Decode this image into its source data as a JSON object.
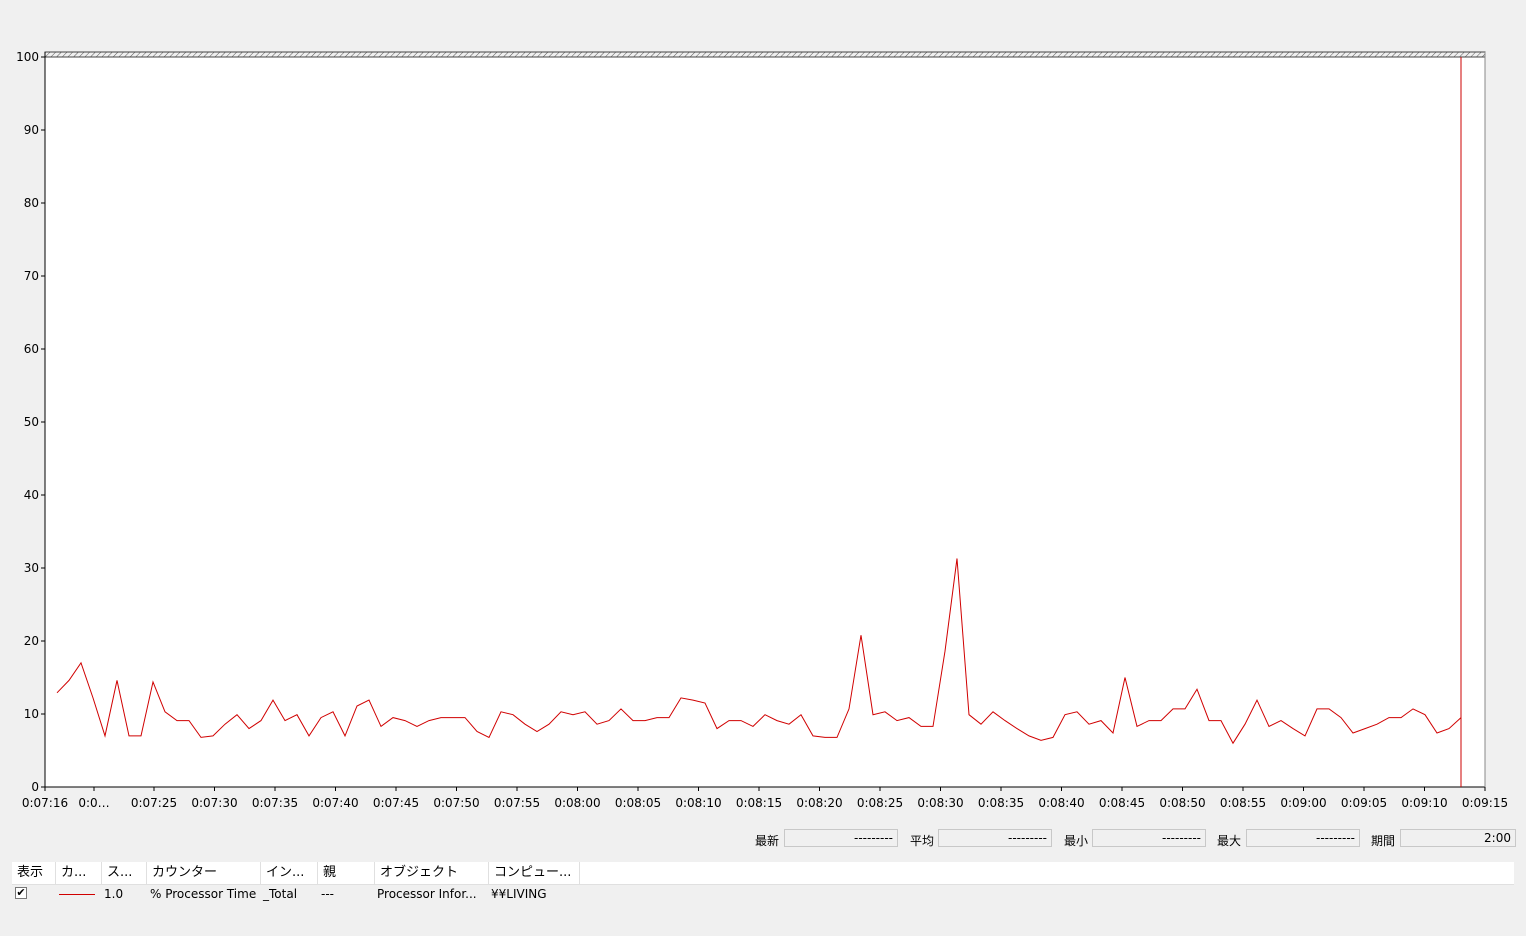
{
  "chart_data": {
    "type": "line",
    "ylim": [
      0,
      100
    ],
    "yticks": [
      "0",
      "10",
      "20",
      "30",
      "40",
      "50",
      "60",
      "70",
      "80",
      "90",
      "100"
    ],
    "xtick_labels": [
      "0:07:16",
      "0:0…",
      "0:07:25",
      "0:07:30",
      "0:07:35",
      "0:07:40",
      "0:07:45",
      "0:07:50",
      "0:07:55",
      "0:08:00",
      "0:08:05",
      "0:08:10",
      "0:08:15",
      "0:08:20",
      "0:08:25",
      "0:08:30",
      "0:08:35",
      "0:08:40",
      "0:08:45",
      "0:08:50",
      "0:08:55",
      "0:09:00",
      "0:09:05",
      "0:09:10",
      "0:09:15"
    ],
    "series": [
      {
        "name": "% Processor Time",
        "color": "#d00000",
        "values": [
          12.9,
          14.6,
          17.0,
          12.2,
          7.0,
          14.6,
          7.0,
          7.0,
          14.4,
          10.3,
          9.1,
          9.1,
          6.8,
          7.0,
          8.6,
          9.9,
          8.0,
          9.1,
          11.9,
          9.1,
          9.9,
          7.0,
          9.5,
          10.3,
          7.0,
          11.1,
          11.9,
          8.3,
          9.5,
          9.1,
          8.3,
          9.1,
          9.5,
          9.5,
          9.5,
          7.6,
          6.8,
          10.3,
          9.9,
          8.6,
          7.6,
          8.6,
          10.3,
          9.9,
          10.3,
          8.6,
          9.1,
          10.7,
          9.1,
          9.1,
          9.5,
          9.5,
          12.2,
          11.9,
          11.5,
          8.0,
          9.1,
          9.1,
          8.3,
          9.9,
          9.1,
          8.6,
          9.9,
          7.0,
          6.8,
          6.8,
          10.7,
          20.8,
          9.9,
          10.3,
          9.1,
          9.5,
          8.3,
          8.3,
          18.6,
          31.3,
          9.9,
          8.6,
          10.3,
          9.1,
          8.0,
          7.0,
          6.4,
          6.8,
          9.9,
          10.3,
          8.6,
          9.1,
          7.4,
          15.0,
          8.3,
          9.1,
          9.1,
          10.7,
          10.7,
          13.4,
          9.1,
          9.1,
          6.0,
          8.6,
          11.9,
          8.3,
          9.1,
          8.0,
          7.0,
          10.7,
          10.7,
          9.5,
          7.4,
          8.0,
          8.6,
          9.5,
          9.5,
          10.7,
          9.9,
          7.4,
          8.0,
          9.5
        ]
      }
    ],
    "time_cursor_color": "#cc0000"
  },
  "stats": {
    "latest_label": "最新",
    "latest_value": "---------",
    "average_label": "平均",
    "average_value": "---------",
    "min_label": "最小",
    "min_value": "---------",
    "max_label": "最大",
    "max_value": "---------",
    "duration_label": "期間",
    "duration_value": "2:00"
  },
  "legend": {
    "columns": [
      "表示",
      "カ...",
      "ス...",
      "カウンター",
      "イン...",
      "親",
      "オブジェクト",
      "コンピュー..."
    ],
    "rows": [
      {
        "show": "✔",
        "color": "#d00000",
        "scale": "1.0",
        "counter": "% Processor Time",
        "instance": "_Total",
        "parent": "---",
        "object": "Processor Infor...",
        "computer": "¥¥LIVING"
      }
    ]
  }
}
